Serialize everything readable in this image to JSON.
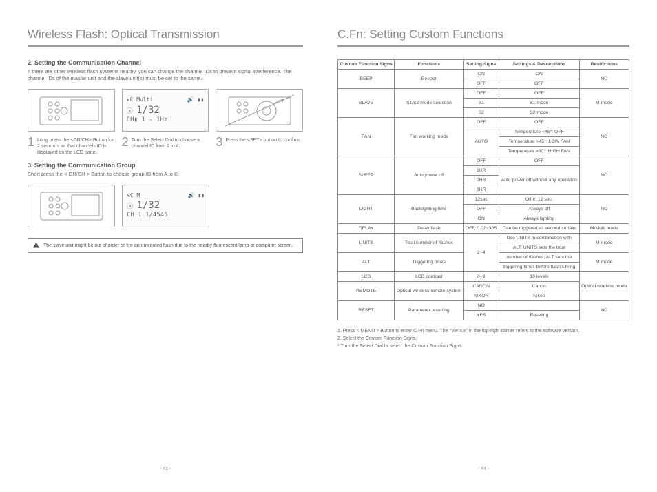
{
  "left": {
    "title": "Wireless Flash: Optical Transmission",
    "section2": {
      "head": "2. Setting the Communication Channel",
      "body": "If there are other wireless flash systems nearby, you can change the channel IDs to prevent signal interference. The channel IDs of the master unit and the slave unit(s) must be set to the same.",
      "lcd_modeline": "✕C   Multi",
      "lcd_power": "1/32",
      "lcd_hz": "1 - 1Hz",
      "step1": "Long press the <GR/CH> Button for 2 seconds so that channels ID is displayed on the LCD panel.",
      "step2": "Turn the Select Dial to choose a channel ID from 1 to 4.",
      "step3": "Press the <SET> button to confirm."
    },
    "section3": {
      "head": "3. Setting the Communication Group",
      "body": "Short press the < GR/CH > Button to choose group ID from A to C.",
      "lcd_modeline": "✕C      M",
      "lcd_power": "1/32",
      "lcd_bottom": "CH 1   1/4545"
    },
    "warning": "The slave unit might be out of order or fire an unwanted flash due to the nearby fluorescent lamp or computer screen.",
    "pagenum": "- 43 -"
  },
  "right": {
    "title": "C.Fn: Setting Custom Functions",
    "headers": {
      "c1": "Custom Function Signs",
      "c2": "Functions",
      "c3": "Setting Signs",
      "c4": "Settings & Descriptions",
      "c5": "Restrictions"
    },
    "rows": {
      "beep_sign": "BEEP",
      "beep_fn": "Beeper",
      "beep_on_s": "ON",
      "beep_on_d": "ON",
      "beep_off_s": "OFF",
      "beep_off_d": "OFF",
      "beep_restr": "NO",
      "slave_sign": "SLAVE",
      "slave_fn": "S1/S2 mode selection",
      "slave_off_s": "OFF",
      "slave_off_d": "OFF",
      "slave_s1_s": "S1",
      "slave_s1_d": "S1 mode",
      "slave_s2_s": "S2",
      "slave_s2_d": "S2 mode",
      "slave_restr": "M mode",
      "fan_sign": "FAN",
      "fan_fn": "Fan working mode",
      "fan_off_s": "OFF",
      "fan_off_d": "OFF",
      "fan_auto_s": "AUTO",
      "fan_a1": "Temperature <45°: OFF",
      "fan_a2": "Temperature >45°: LOW FAN",
      "fan_a3": "Temperature >60°: HIGH FAN",
      "fan_restr": "NO",
      "sleep_sign": "SLEEP",
      "sleep_fn": "Auto power off",
      "sleep_off_s": "OFF",
      "sleep_off_d": "OFF",
      "sleep_1": "1HR",
      "sleep_2": "2HR",
      "sleep_3": "3HR",
      "sleep_d": "Auto power off without any operation",
      "sleep_restr": "NO",
      "light_sign": "LIGHT",
      "light_fn": "Backlighting time",
      "light_12_s": "12sec",
      "light_12_d": "Off in 12 sec.",
      "light_off_s": "OFF",
      "light_off_d": "Always off",
      "light_on_s": "ON",
      "light_on_d": "Always lighting",
      "light_restr": "NO",
      "delay_sign": "DELAY",
      "delay_fn": "Delay flash",
      "delay_s": "OFF, 0.01~30S",
      "delay_d": "Can be triggered as second curtain",
      "delay_restr": "M/Multi mode",
      "units_sign": "UNITS",
      "units_fn": "Total number of flashes",
      "units_s": "2~4",
      "units_d1": "Use UNITS in combination with",
      "units_d2": "ALT: UNITS sets the total",
      "units_restr": "M mode",
      "alt_sign": "ALT",
      "alt_fn": "Triggering times",
      "alt_d1": "number of flashes; ALT sets the",
      "alt_d2": "triggering times before flash's firing",
      "alt_restr": "M mode",
      "lcd_sign": "LCD",
      "lcd_fn": "LCD contrast",
      "lcd_s": "0~9",
      "lcd_d": "10 levels",
      "remote_sign": "REMOTE",
      "remote_fn": "Optical wireless remote system",
      "remote_c_s": "CANON",
      "remote_c_d": "Canon",
      "remote_n_s": "NIKON",
      "remote_n_d": "Nikon",
      "remote_restr": "Optical wireless mode",
      "reset_sign": "RESET",
      "reset_fn": "Parameter resetting",
      "reset_no_s": "NO",
      "reset_no_d": "",
      "reset_yes_s": "YES",
      "reset_yes_d": "Reseting",
      "reset_restr": "NO"
    },
    "footnotes": {
      "n1": "1. Press < MENU > Button to enter C.Fn menu. The \"Ver x.x\" in the top-right corner refers to the software version.",
      "n2": "2. Select the Custom Function Signs.",
      "n3": "* Turn the Select Dial to select the Custom Function Signs."
    },
    "pagenum": "- 44 -"
  }
}
